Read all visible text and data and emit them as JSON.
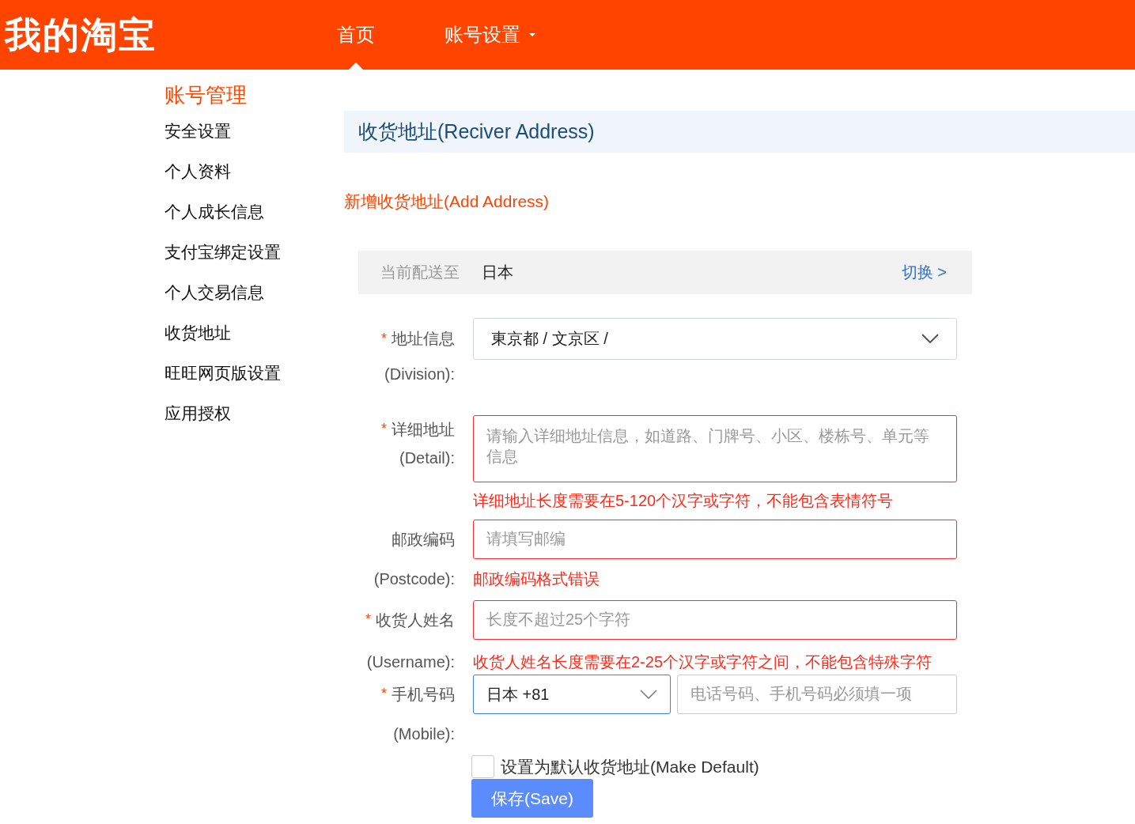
{
  "header": {
    "logo": "我的淘宝",
    "nav": [
      {
        "label": "首页",
        "selected": true,
        "dropdown": false
      },
      {
        "label": "账号设置",
        "selected": false,
        "dropdown": true
      }
    ]
  },
  "sidebar": {
    "heading": "账号管理",
    "items": [
      "安全设置",
      "个人资料",
      "个人成长信息",
      "支付宝绑定设置",
      "个人交易信息",
      "收货地址",
      "旺旺网页版设置",
      "应用授权"
    ]
  },
  "main": {
    "title": "收货地址(Reciver Address)",
    "add_link": "新增收货地址(Add Address)",
    "delivery": {
      "label": "当前配送至",
      "country": "日本",
      "switch": "切换 >"
    },
    "fields": [
      {
        "kind": "select",
        "required_mark": "*",
        "label": "地址信息",
        "label_en": "(Division):",
        "value": "東京都 / 文京区 /"
      },
      {
        "kind": "textarea",
        "required_mark": "*",
        "label": "详细地址",
        "label_en": "(Detail):",
        "placeholder": "请输入详细地址信息，如道路、门牌号、小区、楼栋号、单元等信息",
        "error": "详细地址长度需要在5-120个汉字或字符，不能包含表情符号"
      },
      {
        "kind": "input",
        "label": "邮政编码",
        "label_en": "(Postcode):",
        "placeholder": "请填写邮编",
        "error": "邮政编码格式错误"
      },
      {
        "kind": "input",
        "required_mark": "*",
        "label": "收货人姓名",
        "label_en": "(Username):",
        "placeholder": "长度不超过25个字符",
        "error": "收货人姓名长度需要在2-25个汉字或字符之间，不能包含特殊字符"
      },
      {
        "kind": "phone",
        "required_mark": "*",
        "label": "手机号码",
        "label_en": "(Mobile):",
        "country": "日本 +81",
        "focused": true,
        "placeholder": "电话号码、手机号码必须填一项"
      }
    ],
    "default_checkbox": {
      "label": "设置为默认收货地址(Make Default)",
      "checked": false
    },
    "save_button": "保存(Save)"
  }
}
